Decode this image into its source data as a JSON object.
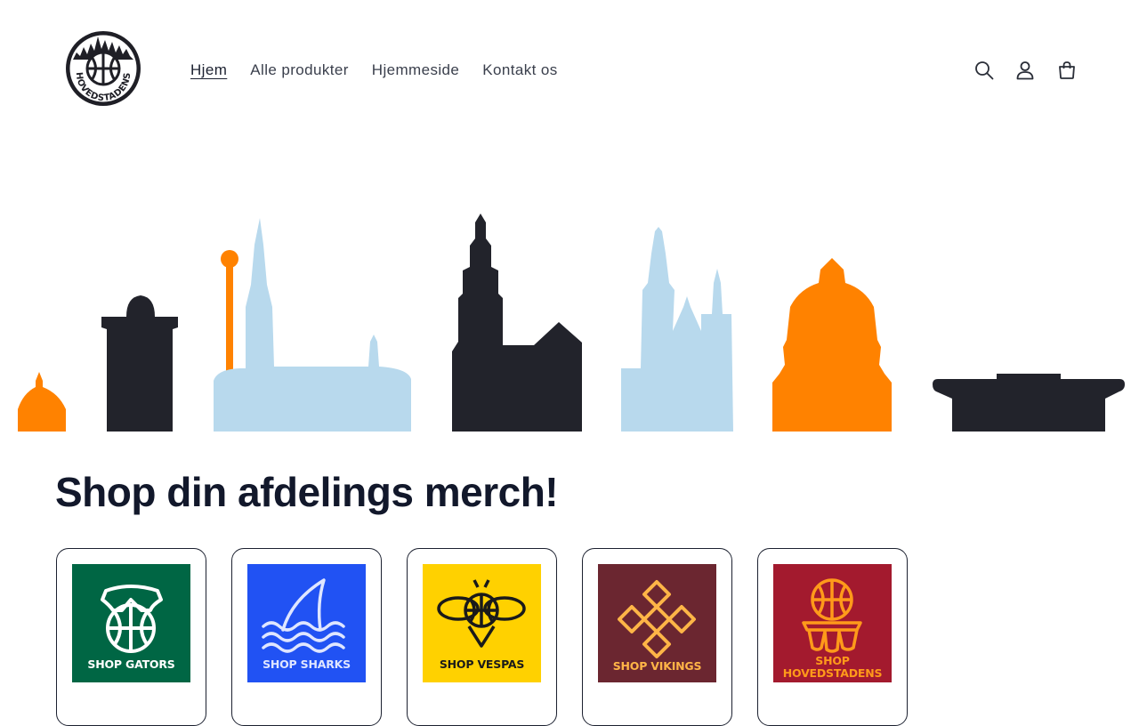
{
  "brand": {
    "logo_text": "HOVEDSTADENS"
  },
  "nav": {
    "items": [
      {
        "label": "Hjem",
        "active": true
      },
      {
        "label": "Alle produkter",
        "active": false
      },
      {
        "label": "Hjemmeside",
        "active": false
      },
      {
        "label": "Kontakt os",
        "active": false
      }
    ]
  },
  "header_icons": [
    "search-icon",
    "account-icon",
    "cart-icon"
  ],
  "hero": {
    "colors": {
      "orange": "#ff8200",
      "dark": "#22232b",
      "lightblue": "#b8d9ed"
    }
  },
  "section": {
    "heading": "Shop din afdelings merch!"
  },
  "collections": [
    {
      "label": "SHOP GATORS",
      "bg": "#006644",
      "text": "#ffffff"
    },
    {
      "label": "SHOP SHARKS",
      "bg": "#2152f3",
      "text": "#dfe6ff"
    },
    {
      "label": "SHOP VESPAS",
      "bg": "#ffd100",
      "text": "#1a1a1a"
    },
    {
      "label": "SHOP VIKINGS",
      "bg": "#6b2630",
      "text": "#ffb547"
    },
    {
      "label_line1": "SHOP",
      "label_line2": "HOVEDSTADENS",
      "bg": "#a31a2e",
      "text": "#ff9a1a"
    }
  ]
}
